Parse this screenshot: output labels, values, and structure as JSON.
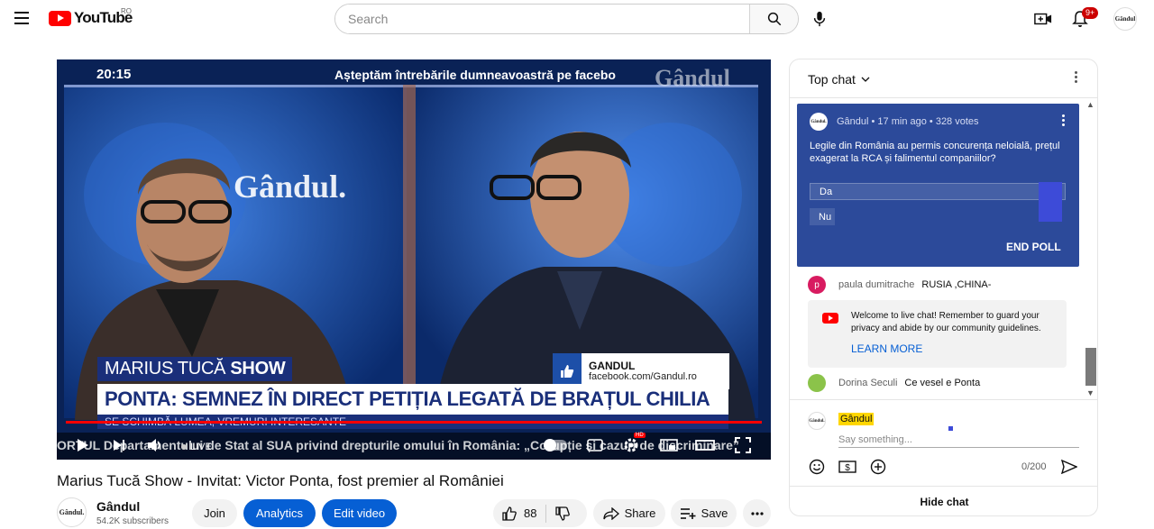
{
  "header": {
    "logo_text": "YouTube",
    "country": "RO",
    "search_placeholder": "Search",
    "notification_count": "9+",
    "avatar_text": "Gândul"
  },
  "player": {
    "caption_time": "20:15",
    "caption_top": "Așteptăm întrebările dumneavoastră pe facebo",
    "watermark": "Gândul",
    "studio_watermark": "Gândul.",
    "show_tag_1": "MARIUS TUCĂ",
    "show_tag_2": "SHOW",
    "fb_name": "GANDUL",
    "fb_url": "facebook.com/Gandul.ro",
    "headline": "PONTA: SEMNEZ ÎN DIRECT PETIȚIA LEGATĂ DE BRAȚUL CHILIA",
    "subline": "SE SCHIMBĂ LUMEA, VREMURI INTERESANTE",
    "ticker": "ORTUL Departamentului de Stat al SUA privind drepturile omului în România: „Corupție și cazuri de discriminare”",
    "live_label": "LIVE",
    "hd_badge": "HD"
  },
  "video": {
    "title": "Marius Tucă Show - Invitat: Victor Ponta, fost premier al României",
    "channel_name": "Gândul",
    "channel_avatar_text": "Gândul.",
    "subscribers": "54.2K subscribers",
    "join_label": "Join",
    "analytics_label": "Analytics",
    "edit_label": "Edit video",
    "likes": "88",
    "share_label": "Share",
    "save_label": "Save"
  },
  "chat": {
    "title": "Top chat",
    "poll": {
      "avatar_text": "Gândul.",
      "meta": "Gândul • 17 min ago • 328 votes",
      "question": "Legile din România au permis concurența neloială, prețul exagerat la RCA și falimentul companiilor?",
      "options": [
        "Da",
        "Nu"
      ],
      "end_label": "END POLL"
    },
    "messages": [
      {
        "avatar": "p",
        "avatar_color": "#d81b60",
        "author": "paula dumitrache",
        "text": "RUSIA ,CHINA-"
      },
      {
        "avatar": "",
        "avatar_color": "#8bc34a",
        "author": "Dorina Seculi",
        "text": "Ce vesel e Ponta"
      }
    ],
    "notice": {
      "text": "Welcome to live chat! Remember to guard your privacy and abide by our community guidelines.",
      "link": "LEARN MORE"
    },
    "input": {
      "avatar_text": "Gândul.",
      "name": "Gândul",
      "placeholder": "Say something...",
      "counter": "0/200"
    },
    "hide_label": "Hide chat"
  }
}
